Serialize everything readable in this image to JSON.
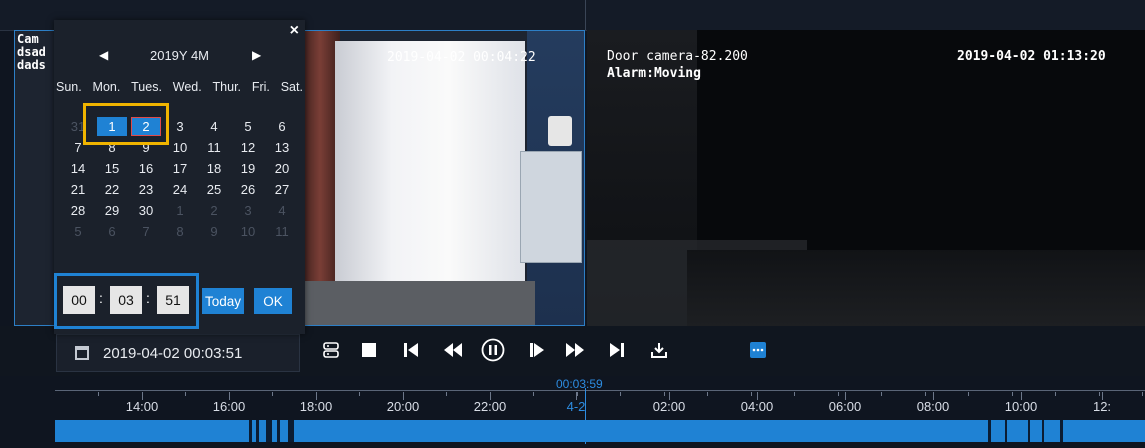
{
  "calendar": {
    "month_label": "2019Y 4M",
    "weekdays": [
      "Sun.",
      "Mon.",
      "Tues.",
      "Wed.",
      "Thur.",
      "Fri.",
      "Sat."
    ],
    "weeks": [
      [
        "31",
        "1",
        "2",
        "3",
        "4",
        "5",
        "6"
      ],
      [
        "7",
        "8",
        "9",
        "10",
        "11",
        "12",
        "13"
      ],
      [
        "14",
        "15",
        "16",
        "17",
        "18",
        "19",
        "20"
      ],
      [
        "21",
        "22",
        "23",
        "24",
        "25",
        "26",
        "27"
      ],
      [
        "28",
        "29",
        "30",
        "1",
        "2",
        "3",
        "4"
      ],
      [
        "5",
        "6",
        "7",
        "8",
        "9",
        "10",
        "11"
      ]
    ],
    "time": {
      "hour": "00",
      "minute": "03",
      "second": "51"
    },
    "today_label": "Today",
    "ok_label": "OK",
    "close_icon": "×"
  },
  "video_left": {
    "camera_label": "Cam\ndsad\ndads",
    "osd_time": "2019-04-02 00:04:22"
  },
  "video_right": {
    "name": "Door camera-82.200",
    "alarm": "Alarm:Moving",
    "osd_time": "2019-04-02 01:13:20"
  },
  "controls": {
    "current_datetime": "2019-04-02 00:03:51"
  },
  "timeline": {
    "cursor_time": "00:03:59",
    "labels": [
      "14:00",
      "16:00",
      "18:00",
      "20:00",
      "22:00",
      "4-2",
      "02:00",
      "04:00",
      "06:00",
      "08:00",
      "10:00",
      "12:"
    ],
    "accent": "#1f82d4"
  }
}
